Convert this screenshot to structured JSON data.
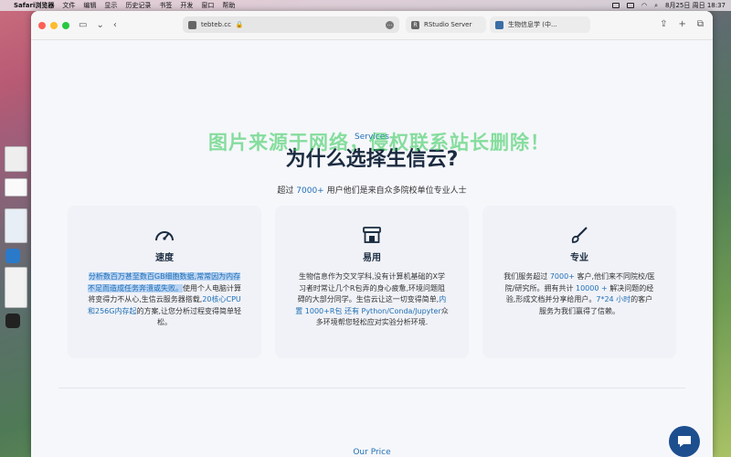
{
  "menubar": {
    "app": "Safari浏览器",
    "items": [
      "文件",
      "编辑",
      "显示",
      "历史记录",
      "书签",
      "开发",
      "窗口",
      "帮助"
    ],
    "datetime": "8月25日 周日 18:37"
  },
  "browser": {
    "tabs": [
      {
        "label": "tebteb.cc",
        "icon": "lock-icon"
      },
      {
        "label": "RStudio Server",
        "icon": "r-icon"
      },
      {
        "label": "生物信息学 (中...",
        "icon": "globe-icon"
      }
    ]
  },
  "page": {
    "section_label": "Services",
    "heading": "为什么选择生信云?",
    "watermark": "图片来源于网络，侵权联系站长删除！",
    "subtitle_prefix": "超过 ",
    "subtitle_count": "7000+",
    "subtitle_suffix": " 用户他们是来自众多院校单位专业人士",
    "cards": [
      {
        "title": "速度",
        "icon": "speedometer-icon",
        "p1": "分析数百万甚至数百GB细胞数据,常常因为内存不足而造成任务奔溃或失败。",
        "p2": "使用个人电脑计算将变得力不从心,生信云服务器搭载,",
        "p3": "20核心CPU和256G内存起",
        "p4": "的方案,让您分析过程变得简单轻松。"
      },
      {
        "title": "易用",
        "icon": "store-icon",
        "p1": "生物信息作为交叉学科,没有计算机基础的X学习者时常让几个R包弄的身心疲惫,环境问题阻碍的大部分同学。生信云让这一切变得简单,",
        "p2": "内置 1000+R包 还有 Python/Conda/Jupyter",
        "p3": "众多环境帮您轻松应对实验分析环境."
      },
      {
        "title": "专业",
        "icon": "paintbrush-icon",
        "p1": "我们服务超过 ",
        "p2": "7000+",
        "p3": " 客户,他们来不同院校/医院/研究所。拥有共计 ",
        "p4": "10000 +",
        "p5": " 解决问题的经验,形成文档并分享给用户。",
        "p6": "7*24 小时",
        "p7": "的客户服务为我们赢得了信赖。"
      }
    ],
    "price_label": "Our Price"
  },
  "colors": {
    "accent": "#1f6fb5",
    "heading": "#1a2b40",
    "chat": "#1d4f8f",
    "watermark": "#28c850"
  }
}
